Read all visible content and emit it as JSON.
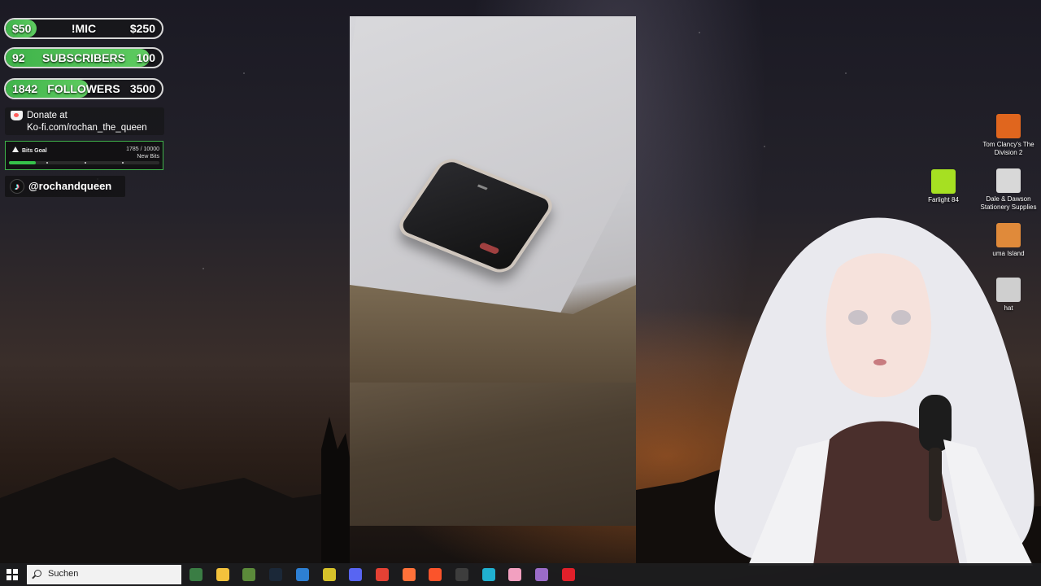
{
  "overlay": {
    "goal_mic": {
      "left": "$50",
      "title": "!MIC",
      "right": "$250",
      "progress": 0.2
    },
    "goal_subscribers": {
      "left": "92",
      "title": "SUBSCRIBERS",
      "right": "100",
      "progress": 0.92
    },
    "goal_followers": {
      "left": "1842",
      "title": "FOLLOWERS",
      "right": "3500",
      "progress": 0.53
    },
    "donate": {
      "line1": "Donate at",
      "line2": "Ko-fi.com/rochan_the_queen"
    },
    "bits_goal": {
      "title": "Bits Goal",
      "count": "1785 / 10000",
      "unit": "New Bits",
      "progress": 0.1785
    },
    "tiktok": {
      "handle": "@rochandqueen"
    }
  },
  "desktop_icons": [
    {
      "label": "Tom Clancy's The Division 2",
      "color": "#e0661e"
    },
    {
      "label": "Farlight 84",
      "color": "#a6e022"
    },
    {
      "label": "Dale & Dawson Stationery Supplies",
      "color": "#d8d8d8"
    },
    {
      "label": "uma Island",
      "color": "#e08a3a"
    },
    {
      "label": "hat",
      "color": "#cfcfcf"
    }
  ],
  "taskbar": {
    "search_placeholder": "Suchen",
    "apps": [
      {
        "name": "calculator-icon",
        "color": "#3a7d44"
      },
      {
        "name": "file-explorer-icon",
        "color": "#f3c23c"
      },
      {
        "name": "minecraft-icon",
        "color": "#5b8a3a"
      },
      {
        "name": "steam-icon",
        "color": "#1b2838"
      },
      {
        "name": "store-icon",
        "color": "#2d7fd3"
      },
      {
        "name": "vivaldi-icon",
        "color": "#d6c22a"
      },
      {
        "name": "discord-icon",
        "color": "#5865f2"
      },
      {
        "name": "chrome-icon",
        "color": "#e44134"
      },
      {
        "name": "firefox-icon",
        "color": "#ff7139"
      },
      {
        "name": "brave-icon",
        "color": "#fb542b"
      },
      {
        "name": "obs-icon",
        "color": "#3d3d3d"
      },
      {
        "name": "app-icon",
        "color": "#20b0d0"
      },
      {
        "name": "vtube-studio-icon",
        "color": "#f2a0c0"
      },
      {
        "name": "app-icon",
        "color": "#9b6cc8"
      },
      {
        "name": "opera-icon",
        "color": "#e0202a"
      }
    ]
  }
}
